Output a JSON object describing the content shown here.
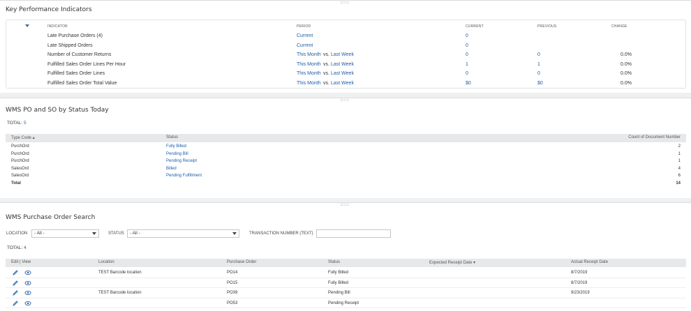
{
  "kpi": {
    "title": "Key Performance Indicators",
    "headers": {
      "indicator": "INDICATOR",
      "period": "PERIOD",
      "current": "CURRENT",
      "previous": "PREVIOUS",
      "change": "CHANGE"
    },
    "rows": [
      {
        "indicator": "Late Purchase Orders (4)",
        "period_a": "Current",
        "period_vs": "",
        "period_b": "",
        "current": "0",
        "previous": "",
        "change": ""
      },
      {
        "indicator": "Late Shipped Orders",
        "period_a": "Current",
        "period_vs": "",
        "period_b": "",
        "current": "0",
        "previous": "",
        "change": ""
      },
      {
        "indicator": "Number of Customer Returns",
        "period_a": "This Month",
        "period_vs": "vs.",
        "period_b": "Last Week",
        "current": "0",
        "previous": "0",
        "change": "0.0%"
      },
      {
        "indicator": "Fulfilled Sales Order Lines Per Hour",
        "period_a": "This Month",
        "period_vs": "vs.",
        "period_b": "Last Week",
        "current": "1",
        "previous": "1",
        "change": "0.0%"
      },
      {
        "indicator": "Fulfilled Sales Order Lines",
        "period_a": "This Month",
        "period_vs": "vs.",
        "period_b": "Last Week",
        "current": "0",
        "previous": "0",
        "change": "0.0%"
      },
      {
        "indicator": "Fulfilled Sales Order Total Value",
        "period_a": "This Month",
        "period_vs": "vs.",
        "period_b": "Last Week",
        "current": "$0",
        "previous": "$0",
        "change": "0.0%"
      }
    ]
  },
  "wms": {
    "title": "WMS PO and SO by Status Today",
    "total_label": "TOTAL:",
    "total_value": "5",
    "headers": {
      "type": "Type Code ▴",
      "status": "Status",
      "count": "Count of Document Number"
    },
    "rows": [
      {
        "type": "PurchOrd",
        "status": "Fully Billed",
        "count": "2"
      },
      {
        "type": "PurchOrd",
        "status": "Pending Bill",
        "count": "1"
      },
      {
        "type": "PurchOrd",
        "status": "Pending Receipt",
        "count": "1"
      },
      {
        "type": "SalesOrd",
        "status": "Billed",
        "count": "4"
      },
      {
        "type": "SalesOrd",
        "status": "Pending Fulfillment",
        "count": "6"
      }
    ],
    "total_row": {
      "label": "Total",
      "count": "14"
    }
  },
  "po_search": {
    "title": "WMS Purchase Order Search",
    "filters": {
      "location_label": "LOCATION",
      "location_value": "- All -",
      "status_label": "STATUS",
      "status_value": "- All -",
      "txn_label": "TRANSACTION NUMBER (TEXT)",
      "txn_value": ""
    },
    "total_label": "TOTAL:",
    "total_value": "4",
    "headers": {
      "editview": "Edit | View",
      "location": "Location",
      "po": "Purchase Order",
      "status": "Status",
      "expected": "Expected Receipt Date ▾",
      "actual": "Actual Receipt Date"
    },
    "rows": [
      {
        "location": "TEST Barcode location",
        "po": "PO14",
        "status": "Fully Billed",
        "expected": "",
        "actual": "8/7/2019"
      },
      {
        "location": "",
        "po": "PO15",
        "status": "Fully Billed",
        "expected": "",
        "actual": "8/7/2019"
      },
      {
        "location": "TEST Barcode location",
        "po": "PO39",
        "status": "Pending Bill",
        "expected": "",
        "actual": "9/23/2019"
      },
      {
        "location": "",
        "po": "PO53",
        "status": "Pending Receipt",
        "expected": "",
        "actual": ""
      }
    ]
  },
  "colors": {
    "link": "#1f5ea8",
    "header_bg": "#e6e8ea",
    "page_bg": "#eef0f2"
  },
  "icons": {
    "edit": "pencil-icon",
    "view": "eye-icon",
    "collapse": "triangle-down-icon"
  }
}
